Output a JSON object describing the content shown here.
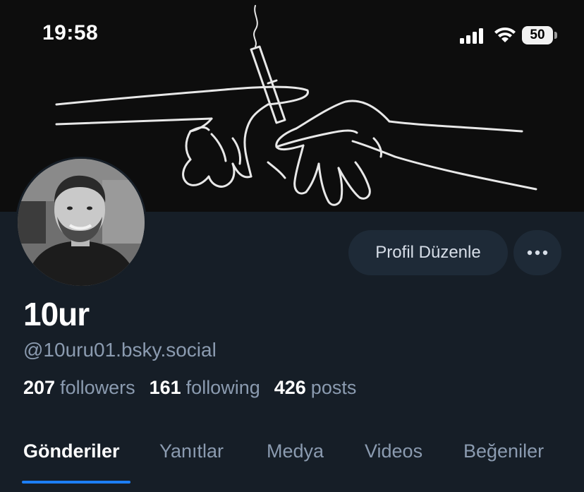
{
  "status_bar": {
    "time": "19:58",
    "battery_level": "50",
    "icons": [
      "cellular-signal-icon",
      "wifi-icon",
      "battery-icon"
    ]
  },
  "banner": {
    "description_icon": "hands-passing-cigarette-drawing"
  },
  "profile": {
    "display_name": "10ur",
    "handle": "@10uru01.bsky.social",
    "edit_button_label": "Profil Düzenle",
    "more_icon": "ellipsis-icon"
  },
  "stats": {
    "followers_count": "207",
    "followers_label": "followers",
    "following_count": "161",
    "following_label": "following",
    "posts_count": "426",
    "posts_label": "posts"
  },
  "tabs": [
    {
      "label": "Gönderiler",
      "active": true
    },
    {
      "label": "Yanıtlar",
      "active": false
    },
    {
      "label": "Medya",
      "active": false
    },
    {
      "label": "Videos",
      "active": false
    },
    {
      "label": "Beğeniler",
      "active": false
    }
  ],
  "colors": {
    "background": "#161e27",
    "button_bg": "#1e2a37",
    "secondary_text": "#8b9bb0",
    "accent": "#1d7ff7"
  }
}
